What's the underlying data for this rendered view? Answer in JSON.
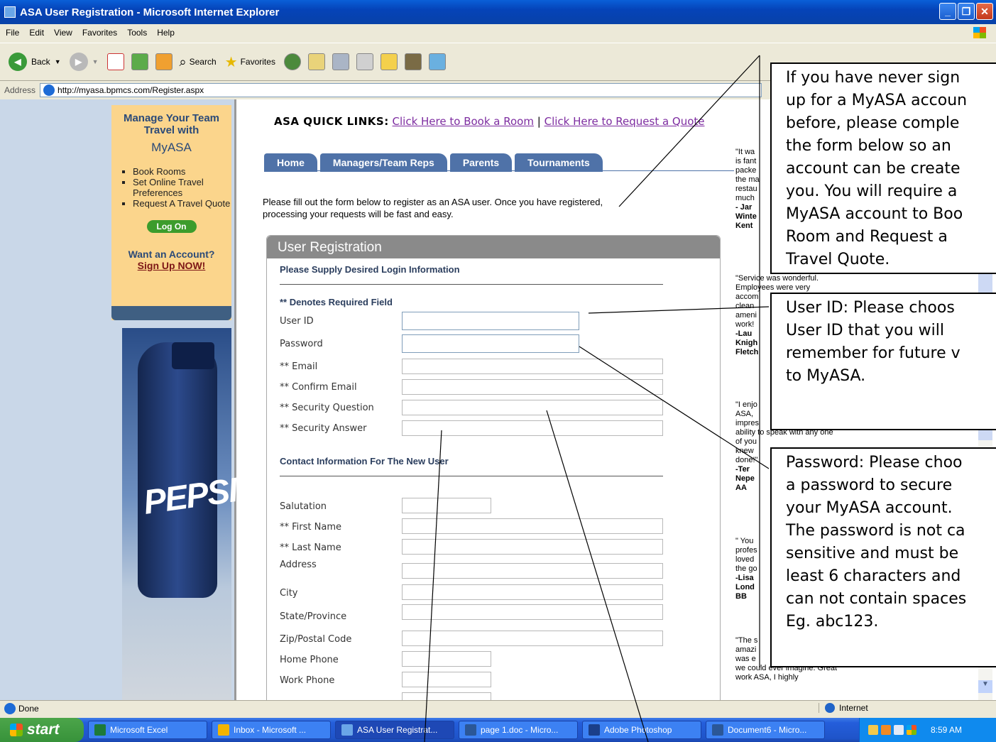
{
  "window": {
    "title": "ASA User Registration - Microsoft Internet Explorer"
  },
  "menu": [
    "File",
    "Edit",
    "View",
    "Favorites",
    "Tools",
    "Help"
  ],
  "toolbar": {
    "back": "Back",
    "search": "Search",
    "favorites": "Favorites"
  },
  "address": {
    "label": "Address",
    "url": "http://myasa.bpmcs.com/Register.aspx"
  },
  "sidebar": {
    "title": "Manage Your Team Travel with",
    "brand": "MyASA",
    "items": [
      "Book Rooms",
      "Set Online Travel Preferences",
      "Request A Travel Quote"
    ],
    "logon": "Log On",
    "want_account": "Want an Account?",
    "signup": "Sign Up NOW!",
    "ad_text": "PEPSI"
  },
  "quicklinks": {
    "label": "ASA QUICK LINKS:",
    "link1": "Click Here to Book a Room",
    "sep": "|",
    "link2": "Click Here to Request a Quote"
  },
  "tabs": [
    "Home",
    "Managers/Team Reps",
    "Parents",
    "Tournaments"
  ],
  "intro": "Please fill out the form below to register as an ASA user. Once you have registered, processing your requests will be fast and easy.",
  "form": {
    "header": "User Registration",
    "section_login": "Please Supply Desired Login Information",
    "required_note": "** Denotes Required Field",
    "login_fields": [
      "User ID",
      "Password",
      "** Email",
      "** Confirm Email",
      "** Security Question",
      "** Security Answer"
    ],
    "section_contact": "Contact Information For The New User",
    "contact_fields": [
      "Salutation",
      "** First Name",
      " ** Last Name",
      "Address",
      "City",
      "State/Province",
      "Zip/Postal Code",
      "Home Phone",
      "Work Phone"
    ]
  },
  "testimonials": {
    "t1": [
      "\"It wa",
      "is fant",
      "packe",
      "the ma",
      "restau",
      "much ",
      " - Jar",
      "Winte",
      "Kent "
    ],
    "t2": [
      "\"Service was wonderful.",
      "Employees were very",
      "accom",
      "clean ",
      "ameni",
      "work!",
      "  -Lau",
      "Knigh",
      "Fletch"
    ],
    "t3": [
      "\"I enjo",
      "ASA, ",
      "impres",
      "ability to speak with any one",
      "of you",
      "knew ",
      "done!\"",
      " -Ter",
      "Nepe",
      "AA"
    ],
    "t4": [
      "\" You",
      "profes",
      "loved ",
      "the go",
      " -Lisa",
      "Lond",
      "BB"
    ],
    "t5": [
      "\"The s",
      "amazi",
      "was e",
      "we could ever imagine. Great",
      "work ASA, I highly"
    ]
  },
  "callouts": {
    "c1": "If you have never sign\nup for a MyASA accoun\nbefore, please comple\nthe form below so an\naccount can be create\nyou. You will require a\nMyASA account to Boo\nRoom and Request a\nTravel Quote.",
    "c2": "User ID: Please choos\nUser ID that you will\nremember for future v\nto MyASA.",
    "c3": "Password: Please choo\na password to secure\nyour MyASA account.\nThe password is not ca\nsensitive and must be\nleast 6 characters and\ncan not contain spaces\nEg. abc123."
  },
  "status": {
    "left": "Done",
    "zone": "Internet"
  },
  "taskbar": {
    "start": "start",
    "buttons": [
      "Microsoft Excel",
      "Inbox - Microsoft ...",
      "ASA User Registrat...",
      "page 1.doc - Micro...",
      "Adobe Photoshop",
      "Document6 - Micro..."
    ],
    "clock": "8:59 AM"
  },
  "colors": {
    "titlebar": "#0543b8",
    "tab": "#4f72a8",
    "sidebar_box": "#fbd58c",
    "link": "#7d2ca0",
    "start": "#37923a"
  }
}
